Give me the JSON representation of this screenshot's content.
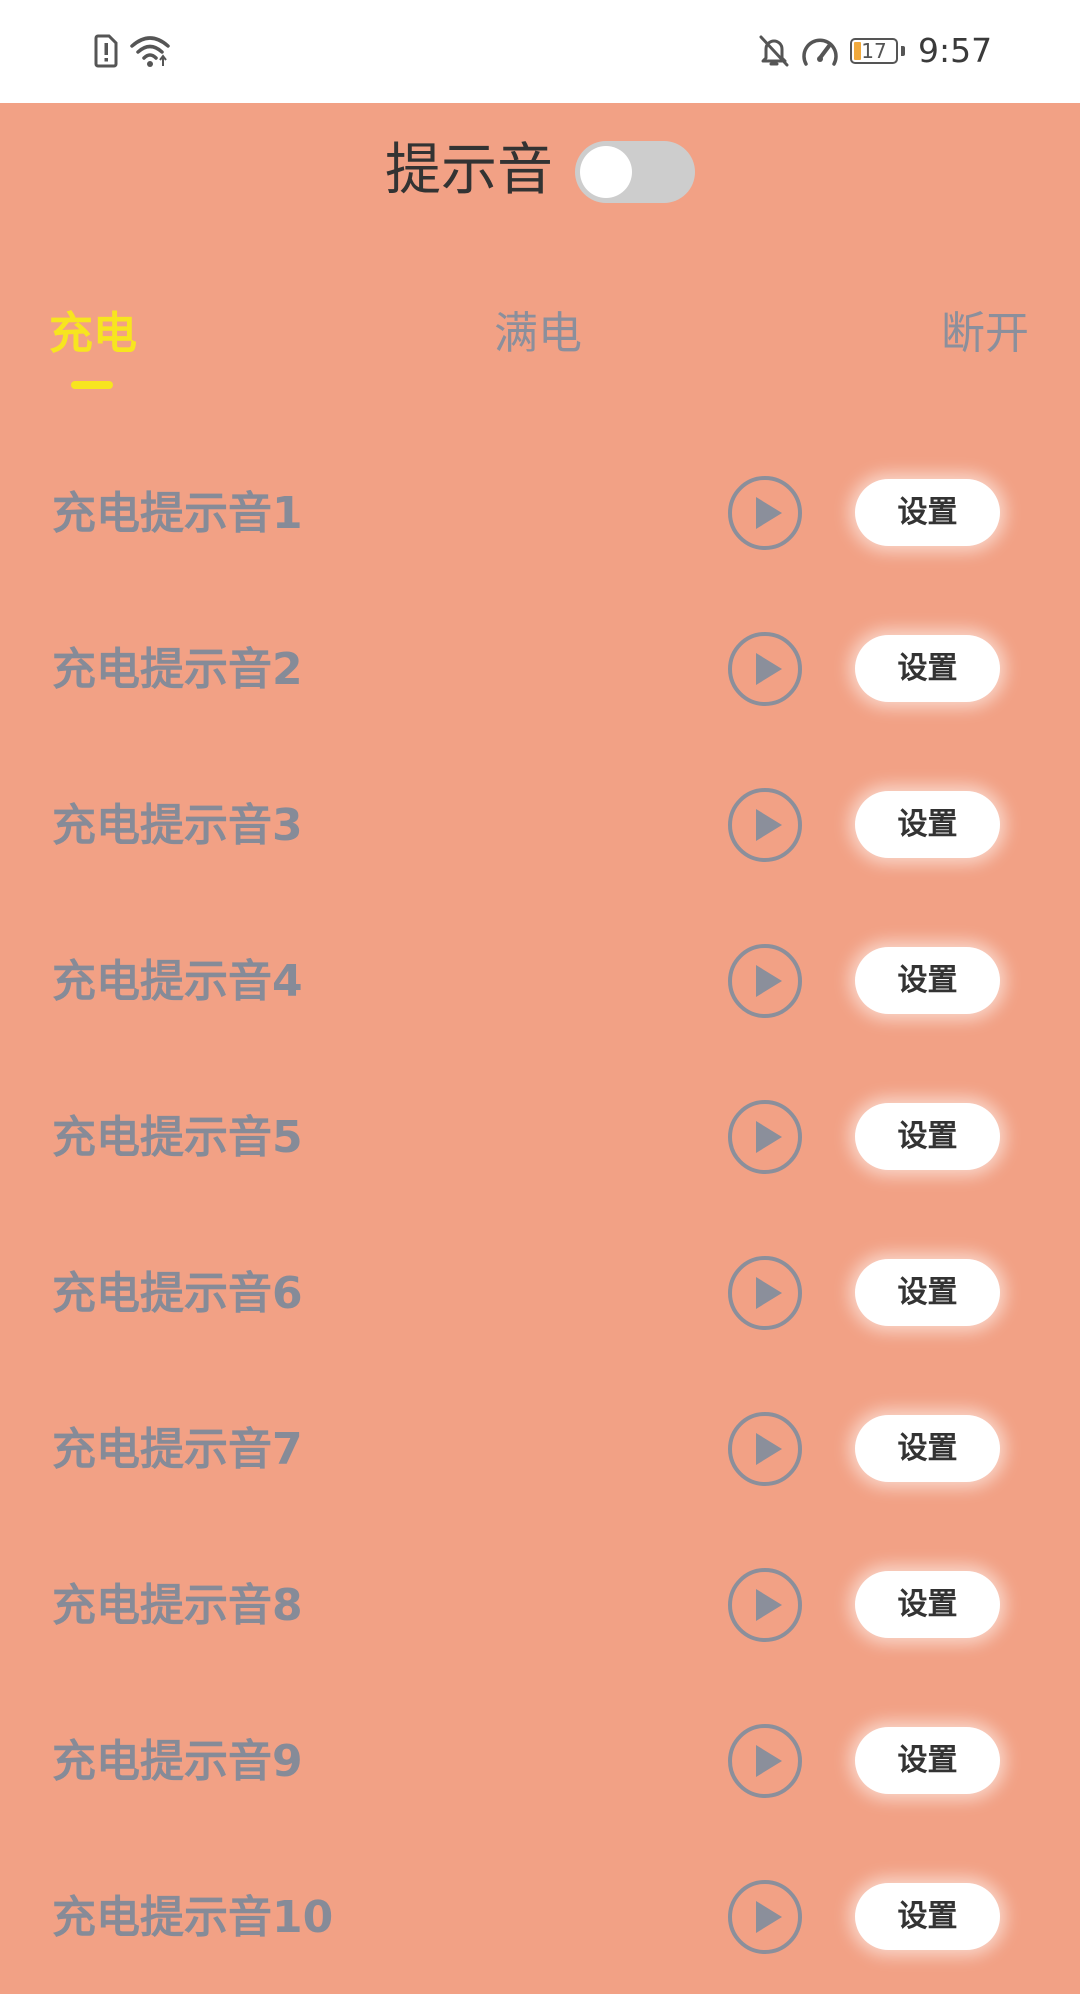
{
  "status_bar": {
    "time": "9:57",
    "battery_level": "17",
    "icons": [
      "sim-alert-icon",
      "wifi-icon",
      "mute-icon",
      "speed-icon",
      "battery-icon"
    ]
  },
  "header": {
    "title": "提示音",
    "toggle_on": false
  },
  "tabs": [
    {
      "label": "充电",
      "active": true
    },
    {
      "label": "满电",
      "active": false
    },
    {
      "label": "断开",
      "active": false
    }
  ],
  "sounds": [
    {
      "label": "充电提示音1",
      "button": "设置"
    },
    {
      "label": "充电提示音2",
      "button": "设置"
    },
    {
      "label": "充电提示音3",
      "button": "设置"
    },
    {
      "label": "充电提示音4",
      "button": "设置"
    },
    {
      "label": "充电提示音5",
      "button": "设置"
    },
    {
      "label": "充电提示音6",
      "button": "设置"
    },
    {
      "label": "充电提示音7",
      "button": "设置"
    },
    {
      "label": "充电提示音8",
      "button": "设置"
    },
    {
      "label": "充电提示音9",
      "button": "设置"
    },
    {
      "label": "充电提示音10",
      "button": "设置"
    }
  ],
  "colors": {
    "background": "#f2a185",
    "accent": "#f7e51f",
    "muted_text": "#868b98",
    "toggle_off": "#cdcdcd"
  }
}
